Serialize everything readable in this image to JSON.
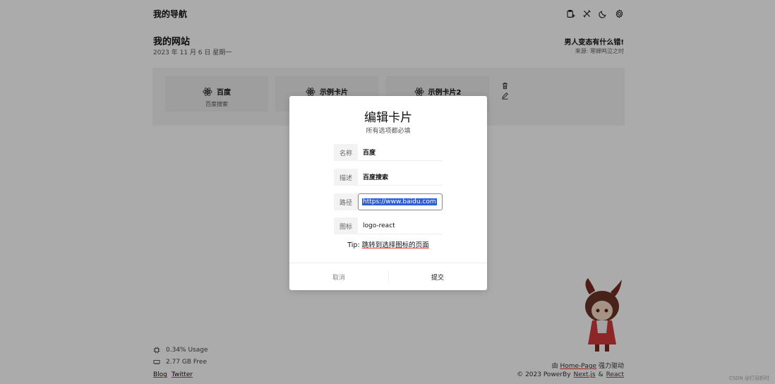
{
  "header": {
    "brand": "我的导航"
  },
  "site": {
    "title": "我的网站",
    "date": "2023 年 11 月 6 日 星期一"
  },
  "quote": {
    "text": "男人变态有什么错!",
    "source": "来源: 寒蝉鸣泣之时"
  },
  "cards": [
    {
      "title": "百度",
      "desc": "百度搜索",
      "icon": "logo-react"
    },
    {
      "title": "示例卡片",
      "desc": "",
      "icon": "logo-react"
    },
    {
      "title": "示例卡片2",
      "desc": "",
      "icon": "logo-react"
    }
  ],
  "footer": {
    "usage": "0.34% Usage",
    "free": "2.77 GB Free",
    "blog": "Blog",
    "twitter": "Twitter",
    "powered_by_line1_prefix": "由",
    "powered_by_line1_link": "Home-Page",
    "powered_by_line1_suffix": "强力驱动",
    "powered_by_line2_prefix": "© 2023 PowerBy",
    "nextjs": "Next.js",
    "amp": "&",
    "react": "React",
    "watermark": "CSDN @打羽折时"
  },
  "modal": {
    "title": "编辑卡片",
    "subtitle": "所有选项都必填",
    "fields": [
      {
        "label": "名称",
        "value": "百度"
      },
      {
        "label": "描述",
        "value": "百度搜索"
      },
      {
        "label": "路径",
        "value": "https://www.baidu.com"
      },
      {
        "label": "图标",
        "value": "logo-react"
      }
    ],
    "tip_prefix": "Tip: ",
    "tip_link": "跳转到选择图标的页面",
    "cancel": "取消",
    "submit": "提交"
  },
  "colors": {
    "accent_red": "#e33333",
    "selection_blue": "#2b5fd9",
    "overlay": "rgba(0,0,0,0.33)"
  }
}
